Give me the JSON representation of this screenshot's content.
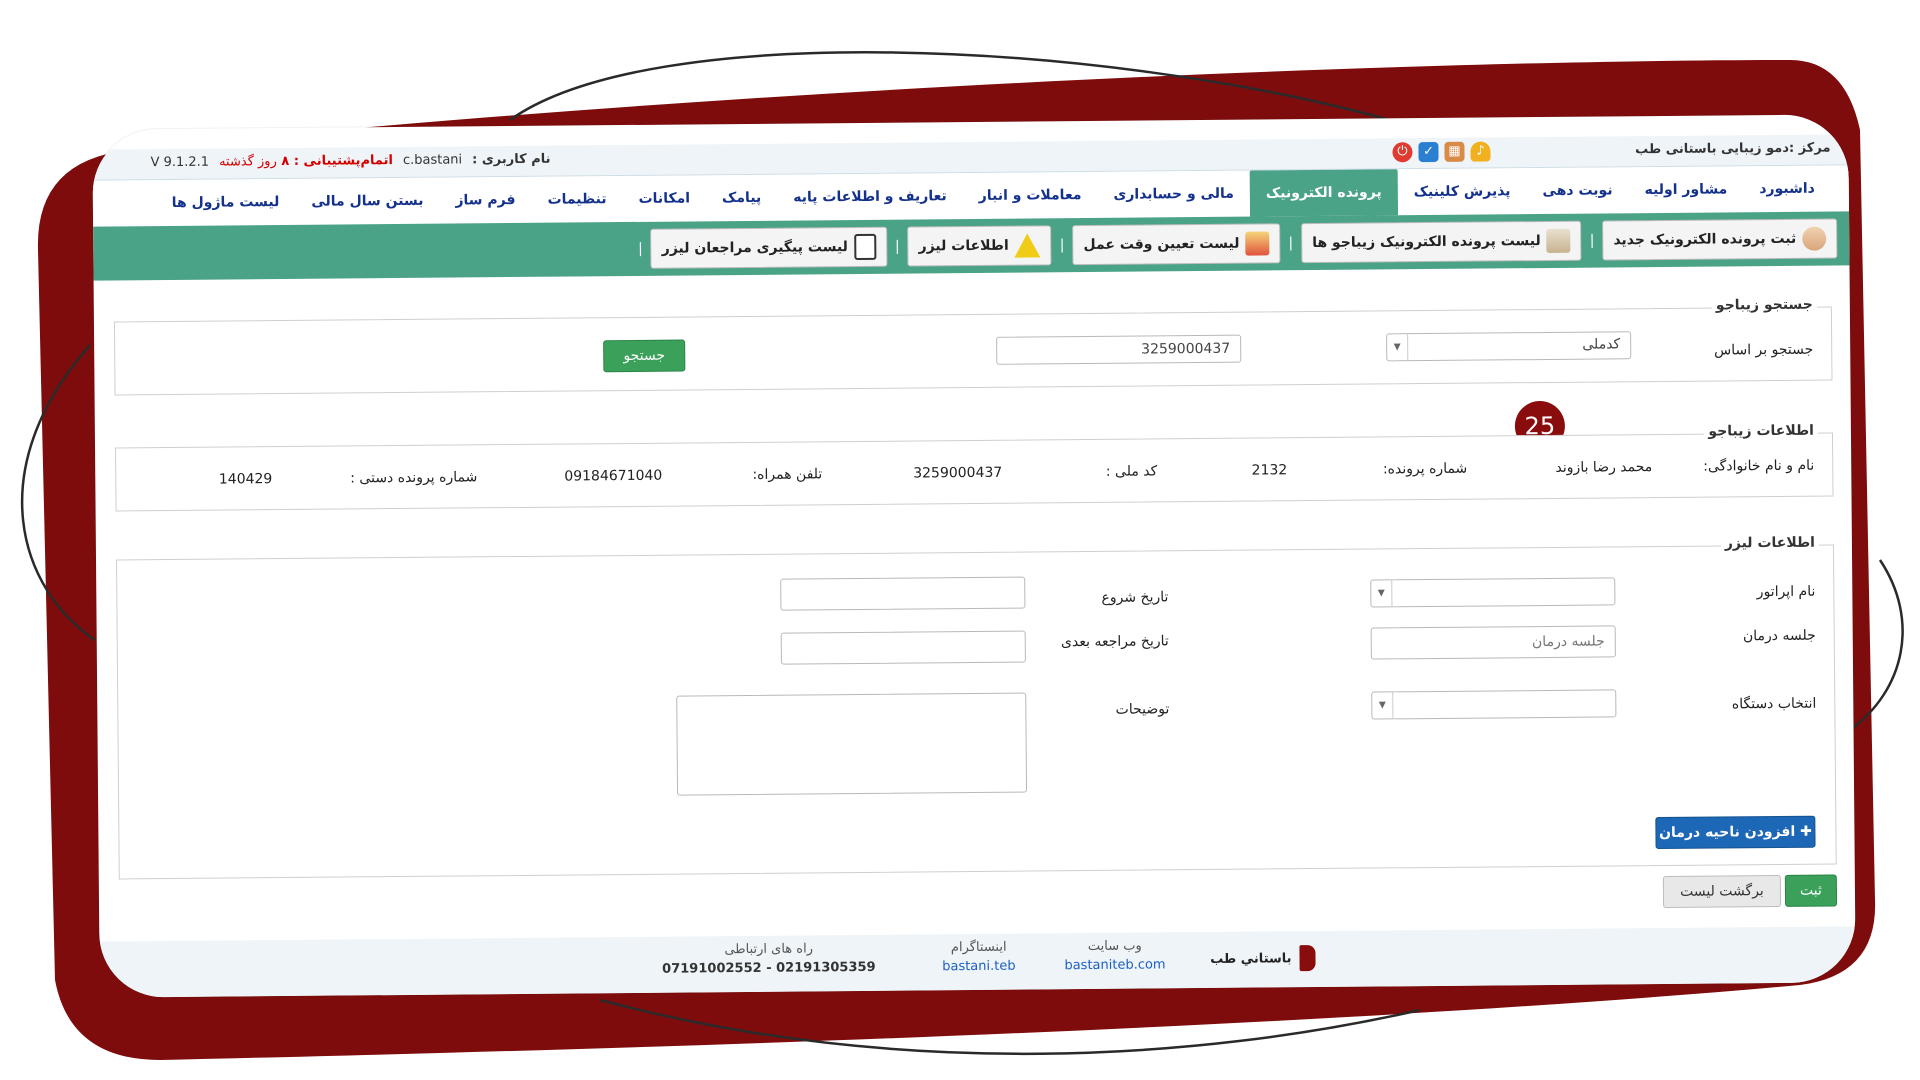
{
  "topbar": {
    "center_name": "مرکز :دمو زیبایی باستانی طب",
    "username_label": "نام کاربری :",
    "username": "c.bastani",
    "support_label": "اتمام‌پشتیبانی : ۸",
    "support_suffix": "روز گذشته",
    "version": "V 9.1.2.1"
  },
  "mainnav": {
    "items": [
      "داشبورد",
      "مشاور اولیه",
      "نوبت دهی",
      "پذیرش کلینیک",
      "پرونده الکترونیک",
      "مالی و حسابداری",
      "معاملات و انبار",
      "تعاریف و اطلاعات پایه",
      "پیامک",
      "امکانات",
      "تنظیمات",
      "فرم ساز",
      "بستن سال مالی",
      "لیست ماژول ها"
    ],
    "active_index": 4
  },
  "subnav": {
    "new_record": "ثبت پرونده الکترونیک جدید",
    "records_list": "لیست پرونده الکترونیک زیباجو ها",
    "appointment_list": "لیست تعیین وقت عمل",
    "laser_info": "اطلاعات لیزر",
    "laser_followup": "لیست پیگیری مراجعان لیزر"
  },
  "search": {
    "legend": "جستجو زیباجو",
    "search_by_label": "جستجو بر اساس",
    "search_by_value": "کدملی",
    "query_value": "3259000437",
    "button": "جستجو"
  },
  "badge": "25",
  "client": {
    "legend": "اطلاعات زیباجو",
    "name_label": "نام و نام خانوادگی:",
    "name": "محمد رضا بازوند",
    "file_no_label": "شماره پرونده:",
    "file_no": "2132",
    "national_id_label": "کد ملی :",
    "national_id": "3259000437",
    "mobile_label": "تلفن همراه:",
    "mobile": "09184671040",
    "manual_file_label": "شماره پرونده دستی :",
    "manual_file": "140429"
  },
  "laser": {
    "legend": "اطلاعات لیزر",
    "operator_label": "نام اپراتور",
    "start_date_label": "تاریخ شروع",
    "session_label": "جلسه درمان",
    "session_placeholder": "جلسه درمان",
    "next_visit_label": "تاریخ مراجعه بعدی",
    "device_label": "انتخاب دستگاه",
    "notes_label": "توضیحات",
    "add_area_button": "افزودن ناحیه درمان"
  },
  "actions": {
    "submit": "ثبت",
    "back": "برگشت لیست"
  },
  "footer": {
    "brand": "باستاني طب",
    "website_caption": "وب سایت",
    "website": "bastaniteb.com",
    "instagram_caption": "اینستاگرام",
    "instagram": "bastani.teb",
    "contact_caption": "راه های ارتباطی",
    "phones": "07191002552 - 02191305359"
  },
  "colors": {
    "frame": "#7f0c0c",
    "accent_green": "#4aa287",
    "nav_text": "#14318c",
    "button_blue": "#1c67b6",
    "badge": "#8a0d0d"
  }
}
